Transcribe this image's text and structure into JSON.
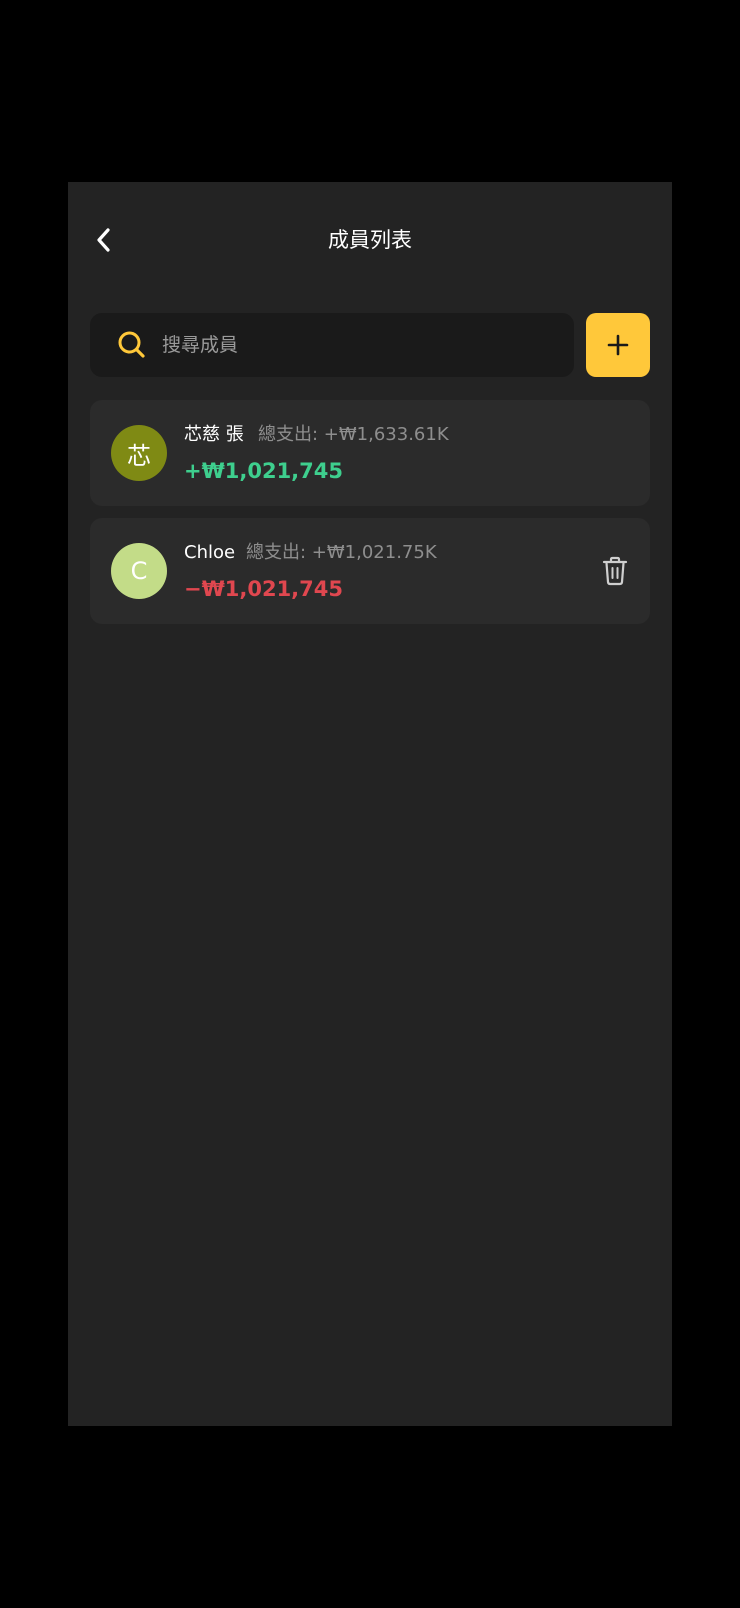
{
  "header": {
    "title": "成員列表",
    "back_icon": "chevron-left-icon"
  },
  "search": {
    "placeholder": "搜尋成員",
    "value": "",
    "icon": "search-icon"
  },
  "add_button": {
    "icon": "plus-icon"
  },
  "members": [
    {
      "avatar_text": "芯",
      "avatar_color": "#7f8a14",
      "name": "芯慈 張",
      "total_spend": "總支出: +₩1,633.61K",
      "balance": "+₩1,021,745",
      "balance_color": "#3ecf8e",
      "has_delete": false
    },
    {
      "avatar_text": "C",
      "avatar_color": "#c3dc88",
      "name": "Chloe",
      "total_spend": "總支出: +₩1,021.75K",
      "balance": "−₩1,021,745",
      "balance_color": "#e0474f",
      "has_delete": true,
      "delete_icon": "trash-icon"
    }
  ],
  "colors": {
    "background": "#232323",
    "card": "#2b2b2b",
    "accent": "#ffc83a",
    "search_bg": "#1a1a1a"
  }
}
